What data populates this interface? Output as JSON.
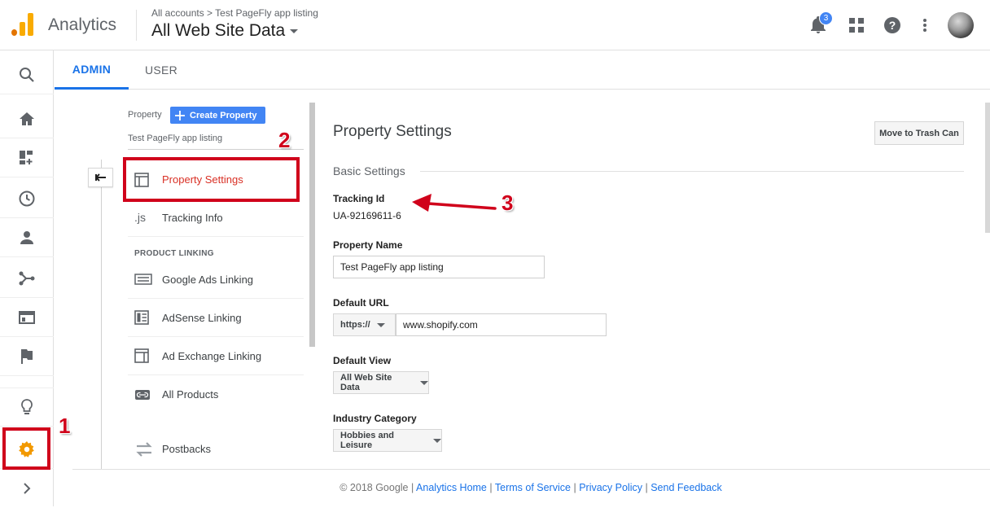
{
  "app": {
    "brand": "Analytics",
    "breadcrumb": "All accounts > Test PageFly app listing",
    "current_view": "All Web Site Data",
    "notification_count": "3"
  },
  "tabs": [
    {
      "label": "ADMIN"
    },
    {
      "label": "USER"
    }
  ],
  "nav": {
    "property_label": "Property",
    "create_property_label": "Create Property",
    "selected_property": "Test PageFly app listing",
    "items": [
      {
        "label": "Property Settings",
        "icon": "property-settings-icon"
      },
      {
        "label": "Tracking Info",
        "icon": "js-icon",
        "icon_text": ".js"
      },
      {
        "label": "Google Ads Linking",
        "icon": "ads-linking-icon"
      },
      {
        "label": "AdSense Linking",
        "icon": "adsense-icon"
      },
      {
        "label": "Ad Exchange Linking",
        "icon": "ad-exchange-icon"
      },
      {
        "label": "All Products",
        "icon": "link-icon"
      },
      {
        "label": "Postbacks",
        "icon": "postbacks-icon"
      }
    ],
    "section_product_linking": "PRODUCT LINKING"
  },
  "main": {
    "title": "Property Settings",
    "trash_button": "Move to Trash Can",
    "basic_settings": "Basic Settings",
    "tracking_id_label": "Tracking Id",
    "tracking_id_value": "UA-92169611-6",
    "property_name_label": "Property Name",
    "property_name_value": "Test PageFly app listing",
    "default_url_label": "Default URL",
    "protocol": "https://",
    "default_url_value": "www.shopify.com",
    "default_view_label": "Default View",
    "default_view_value": "All Web Site Data",
    "industry_label": "Industry Category",
    "industry_value": "Hobbies and Leisure"
  },
  "footer": {
    "copyright": "© 2018 Google",
    "links": [
      "Analytics Home",
      "Terms of Service",
      "Privacy Policy",
      "Send Feedback"
    ],
    "separator": "|"
  },
  "annotations": [
    "1",
    "2",
    "3"
  ],
  "colors": {
    "accent_blue": "#1a73e8",
    "annotation_red": "#d0021b",
    "active_red": "#d93025",
    "logo_orange": "#f9ab00",
    "logo_dark_orange": "#e37400"
  }
}
